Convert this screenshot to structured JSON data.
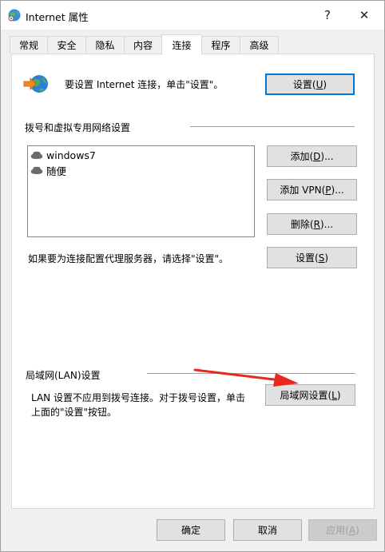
{
  "window": {
    "title": "Internet 属性",
    "help_glyph": "?",
    "close_glyph": "✕"
  },
  "tabs": [
    {
      "label": "常规",
      "active": false
    },
    {
      "label": "安全",
      "active": false
    },
    {
      "label": "隐私",
      "active": false
    },
    {
      "label": "内容",
      "active": false
    },
    {
      "label": "连接",
      "active": true
    },
    {
      "label": "程序",
      "active": false
    },
    {
      "label": "高级",
      "active": false
    }
  ],
  "setup": {
    "text": "要设置 Internet 连接，单击\"设置\"。",
    "button_label": "设置(",
    "button_key": "U",
    "button_tail": ")"
  },
  "dialup": {
    "section_title": "拨号和虚拟专用网络设置",
    "connections": [
      "windows7",
      "随便"
    ],
    "add_label": "添加(",
    "add_key": "D",
    "add_tail": ")...",
    "add_vpn_label": "添加 VPN(",
    "add_vpn_key": "P",
    "add_vpn_tail": ")...",
    "delete_label": "删除(",
    "delete_key": "R",
    "delete_tail": ")...",
    "proxy_text": "如果要为连接配置代理服务器，请选择\"设置\"。",
    "settings_label": "设置(",
    "settings_key": "S",
    "settings_tail": ")"
  },
  "lan": {
    "section_title": "局域网(LAN)设置",
    "desc_line1": "LAN 设置不应用到拨号连接。对于拨号设置，单击",
    "desc_line2": "上面的\"设置\"按钮。",
    "button_label": "局域网设置(",
    "button_key": "L",
    "button_tail": ")"
  },
  "footer": {
    "ok_label": "确定",
    "cancel_label": "取消",
    "apply_label": "应用(",
    "apply_key": "A",
    "apply_tail": ")"
  },
  "colors": {
    "annotation_arrow": "#e8281e",
    "focus_border": "#0078d7"
  }
}
